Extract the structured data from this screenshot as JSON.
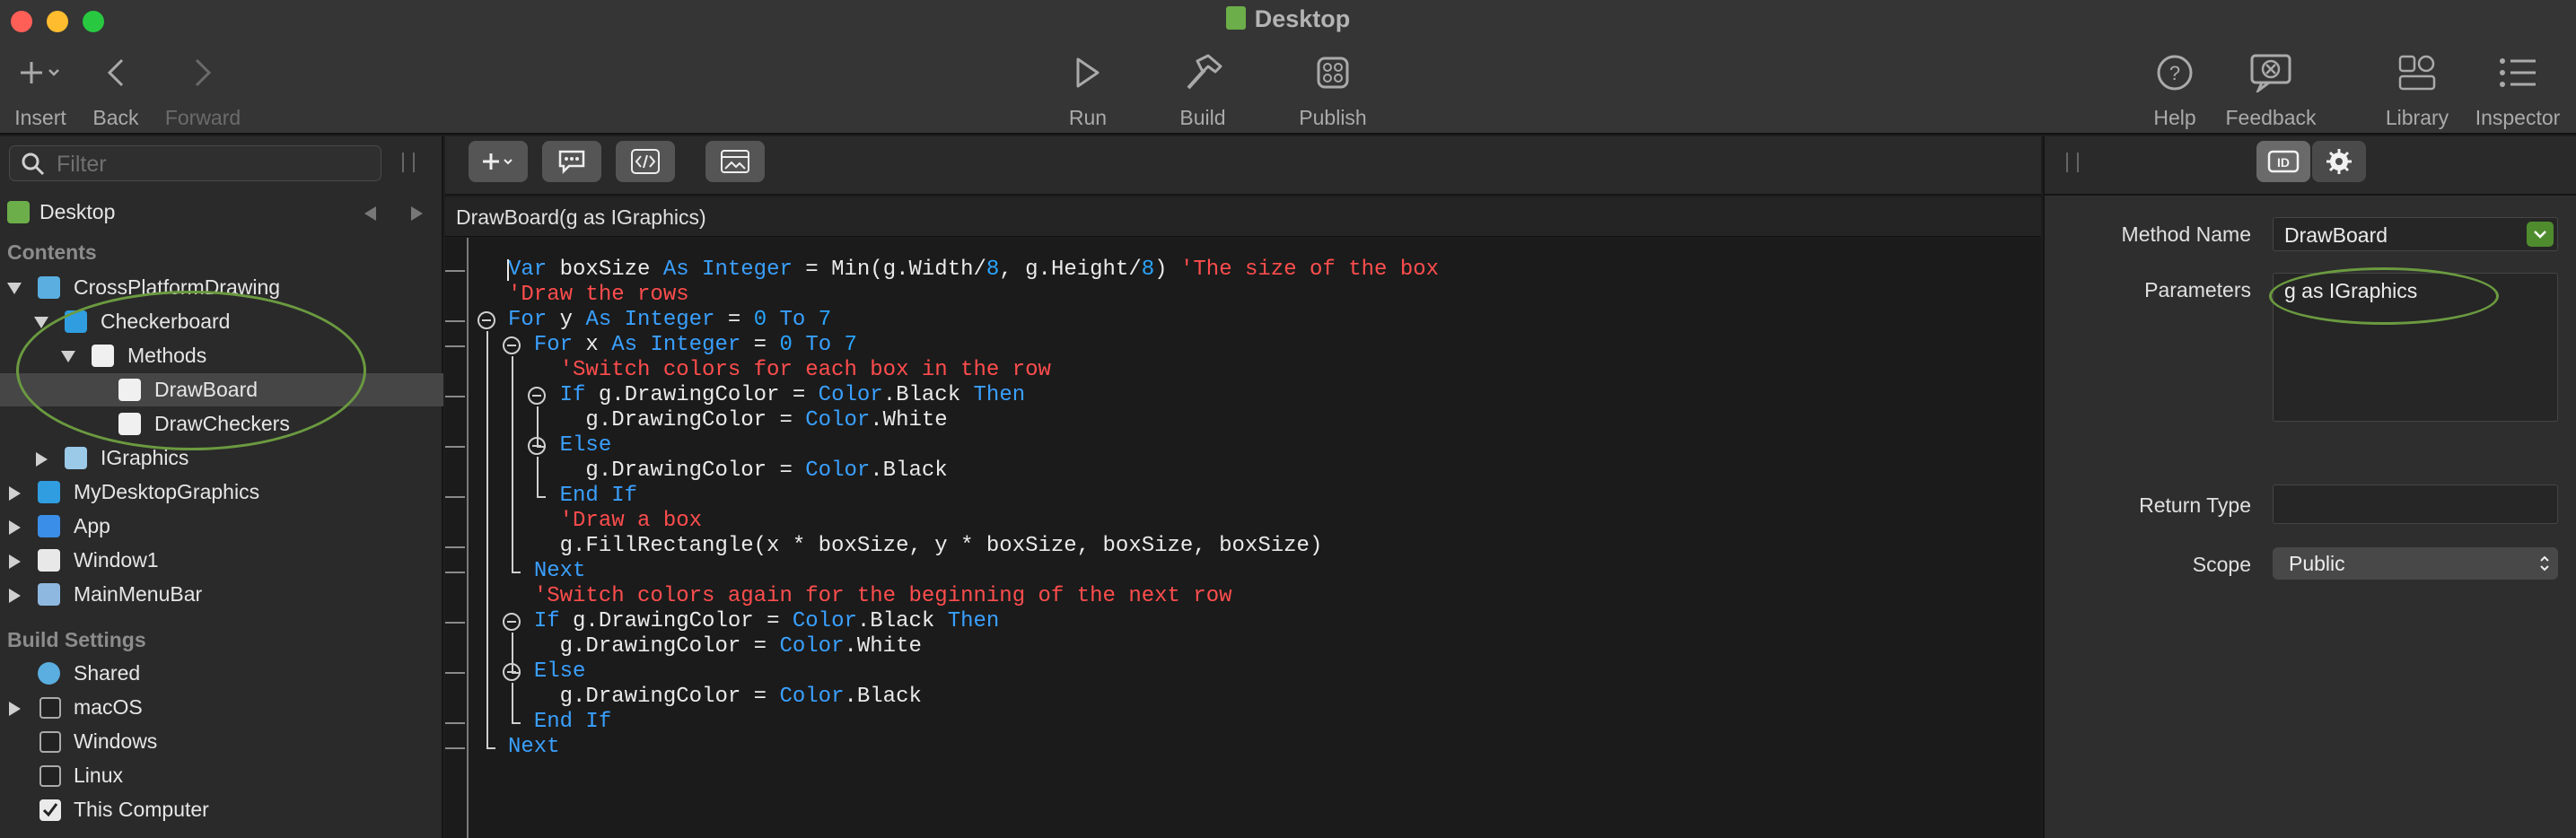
{
  "window": {
    "title": "Desktop"
  },
  "toolbar": {
    "insert": "Insert",
    "back": "Back",
    "forward": "Forward",
    "run": "Run",
    "build": "Build",
    "publish": "Publish",
    "help": "Help",
    "feedback": "Feedback",
    "library": "Library",
    "inspector": "Inspector"
  },
  "navigator": {
    "filter_placeholder": "Filter",
    "project": "Desktop",
    "contents_header": "Contents",
    "items": [
      {
        "label": "CrossPlatformDrawing"
      },
      {
        "label": "Checkerboard"
      },
      {
        "label": "Methods"
      },
      {
        "label": "DrawBoard"
      },
      {
        "label": "DrawCheckers"
      },
      {
        "label": "IGraphics"
      },
      {
        "label": "MyDesktopGraphics"
      },
      {
        "label": "App"
      },
      {
        "label": "Window1"
      },
      {
        "label": "MainMenuBar"
      }
    ],
    "build_header": "Build Settings",
    "build_items": [
      {
        "label": "Shared"
      },
      {
        "label": "macOS"
      },
      {
        "label": "Windows"
      },
      {
        "label": "Linux"
      },
      {
        "label": "This Computer"
      }
    ]
  },
  "editor": {
    "signature": "DrawBoard(g as IGraphics)",
    "lines": [
      {
        "p": [
          [
            "k",
            "Var"
          ],
          [
            "w",
            " boxSize "
          ],
          [
            "k",
            "As Integer"
          ],
          [
            "w",
            " = Min(g.Width/"
          ],
          [
            "n",
            "8"
          ],
          [
            "w",
            ", g.Height/"
          ],
          [
            "n",
            "8"
          ],
          [
            "w",
            ") "
          ],
          [
            "c",
            "'The size of the box"
          ]
        ]
      },
      {
        "p": [
          [
            "c",
            "'Draw the rows"
          ]
        ]
      },
      {
        "p": [
          [
            "k",
            "For"
          ],
          [
            "w",
            " y "
          ],
          [
            "k",
            "As Integer"
          ],
          [
            "w",
            " = "
          ],
          [
            "n",
            "0"
          ],
          [
            "w",
            " "
          ],
          [
            "k",
            "To"
          ],
          [
            "w",
            " "
          ],
          [
            "n",
            "7"
          ]
        ]
      },
      {
        "p": [
          [
            "w",
            "  "
          ],
          [
            "k",
            "For"
          ],
          [
            "w",
            " x "
          ],
          [
            "k",
            "As Integer"
          ],
          [
            "w",
            " = "
          ],
          [
            "n",
            "0"
          ],
          [
            "w",
            " "
          ],
          [
            "k",
            "To"
          ],
          [
            "w",
            " "
          ],
          [
            "n",
            "7"
          ]
        ]
      },
      {
        "p": [
          [
            "w",
            "    "
          ],
          [
            "c",
            "'Switch colors for each box in the row"
          ]
        ]
      },
      {
        "p": [
          [
            "w",
            "    "
          ],
          [
            "k",
            "If"
          ],
          [
            "w",
            " g.DrawingColor = "
          ],
          [
            "t",
            "Color"
          ],
          [
            "w",
            ".Black "
          ],
          [
            "k",
            "Then"
          ]
        ]
      },
      {
        "p": [
          [
            "w",
            "      g.DrawingColor = "
          ],
          [
            "t",
            "Color"
          ],
          [
            "w",
            ".White"
          ]
        ]
      },
      {
        "p": [
          [
            "w",
            "    "
          ],
          [
            "k",
            "Else"
          ]
        ]
      },
      {
        "p": [
          [
            "w",
            "      g.DrawingColor = "
          ],
          [
            "t",
            "Color"
          ],
          [
            "w",
            ".Black"
          ]
        ]
      },
      {
        "p": [
          [
            "w",
            "    "
          ],
          [
            "k",
            "End If"
          ]
        ]
      },
      {
        "p": [
          [
            "w",
            "    "
          ],
          [
            "c",
            "'Draw a box"
          ]
        ]
      },
      {
        "p": [
          [
            "w",
            "    g.FillRectangle(x * boxSize, y * boxSize, boxSize, boxSize)"
          ]
        ]
      },
      {
        "p": [
          [
            "w",
            "  "
          ],
          [
            "k",
            "Next"
          ]
        ]
      },
      {
        "p": [
          [
            "w",
            "  "
          ],
          [
            "c",
            "'Switch colors again for the beginning of the next row"
          ]
        ]
      },
      {
        "p": [
          [
            "w",
            "  "
          ],
          [
            "k",
            "If"
          ],
          [
            "w",
            " g.DrawingColor = "
          ],
          [
            "t",
            "Color"
          ],
          [
            "w",
            ".Black "
          ],
          [
            "k",
            "Then"
          ]
        ]
      },
      {
        "p": [
          [
            "w",
            "    g.DrawingColor = "
          ],
          [
            "t",
            "Color"
          ],
          [
            "w",
            ".White"
          ]
        ]
      },
      {
        "p": [
          [
            "w",
            "  "
          ],
          [
            "k",
            "Else"
          ]
        ]
      },
      {
        "p": [
          [
            "w",
            "    g.DrawingColor = "
          ],
          [
            "t",
            "Color"
          ],
          [
            "w",
            ".Black"
          ]
        ]
      },
      {
        "p": [
          [
            "w",
            "  "
          ],
          [
            "k",
            "End If"
          ]
        ]
      },
      {
        "p": [
          [
            "k",
            "Next"
          ]
        ]
      }
    ]
  },
  "inspector": {
    "method_name_label": "Method Name",
    "method_name_value": "DrawBoard",
    "parameters_label": "Parameters",
    "parameters_value": "g as IGraphics",
    "return_type_label": "Return Type",
    "return_type_value": "",
    "scope_label": "Scope",
    "scope_value": "Public"
  },
  "colors": {
    "accent_green": "#6b9a40",
    "keyword": "#3aa0ff",
    "comment": "#ff4d4d"
  }
}
